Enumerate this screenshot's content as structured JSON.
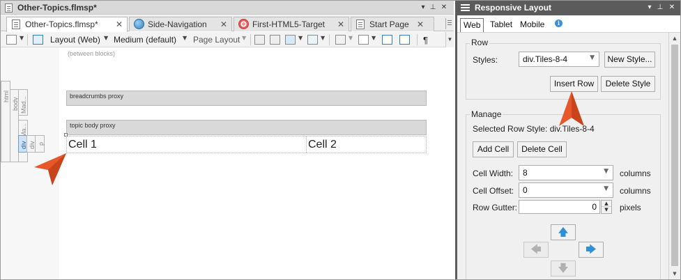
{
  "editor": {
    "window_title": "Other-Topics.flmsp*",
    "tabs": [
      {
        "label": "Other-Topics.flmsp*",
        "icon": "document-icon"
      },
      {
        "label": "Side-Navigation",
        "icon": "globe-icon"
      },
      {
        "label": "First-HTML5-Target",
        "icon": "target-icon"
      },
      {
        "label": "Start Page",
        "icon": "document-icon"
      }
    ],
    "toolbar": {
      "layout": "Layout (Web)",
      "medium": "Medium (default)",
      "page_layout": "Page Layout",
      "pilcrow": "¶"
    },
    "canvas": {
      "between_blocks": "(between blocks)",
      "structure_bars": [
        "html",
        "body",
        "Mad...",
        "Ma...",
        "div",
        "div",
        "p"
      ],
      "breadcrumbs_proxy": "breadcrumbs proxy",
      "topic_body_proxy": "topic body proxy",
      "cells": [
        "Cell 1",
        "Cell 2"
      ]
    }
  },
  "panel": {
    "title": "Responsive Layout",
    "tabs": [
      "Web",
      "Tablet",
      "Mobile"
    ],
    "row": {
      "group_label": "Row",
      "styles_label": "Styles:",
      "styles_value": "div.Tiles-8-4",
      "new_style": "New Style...",
      "insert_row": "Insert Row",
      "delete_style": "Delete Style"
    },
    "manage": {
      "group_label": "Manage",
      "selected_row_style": "Selected Row Style: div.Tiles-8-4",
      "add_cell": "Add Cell",
      "delete_cell": "Delete Cell",
      "cell_width_label": "Cell Width:",
      "cell_width_value": "8",
      "cell_offset_label": "Cell Offset:",
      "cell_offset_value": "0",
      "row_gutter_label": "Row Gutter:",
      "row_gutter_value": "0",
      "columns_unit": "columns",
      "pixels_unit": "pixels"
    }
  },
  "colors": {
    "panel_title_bg": "#5b5b5b",
    "pointer": "#e8572a",
    "arrow_active": "#2f8fd7"
  }
}
